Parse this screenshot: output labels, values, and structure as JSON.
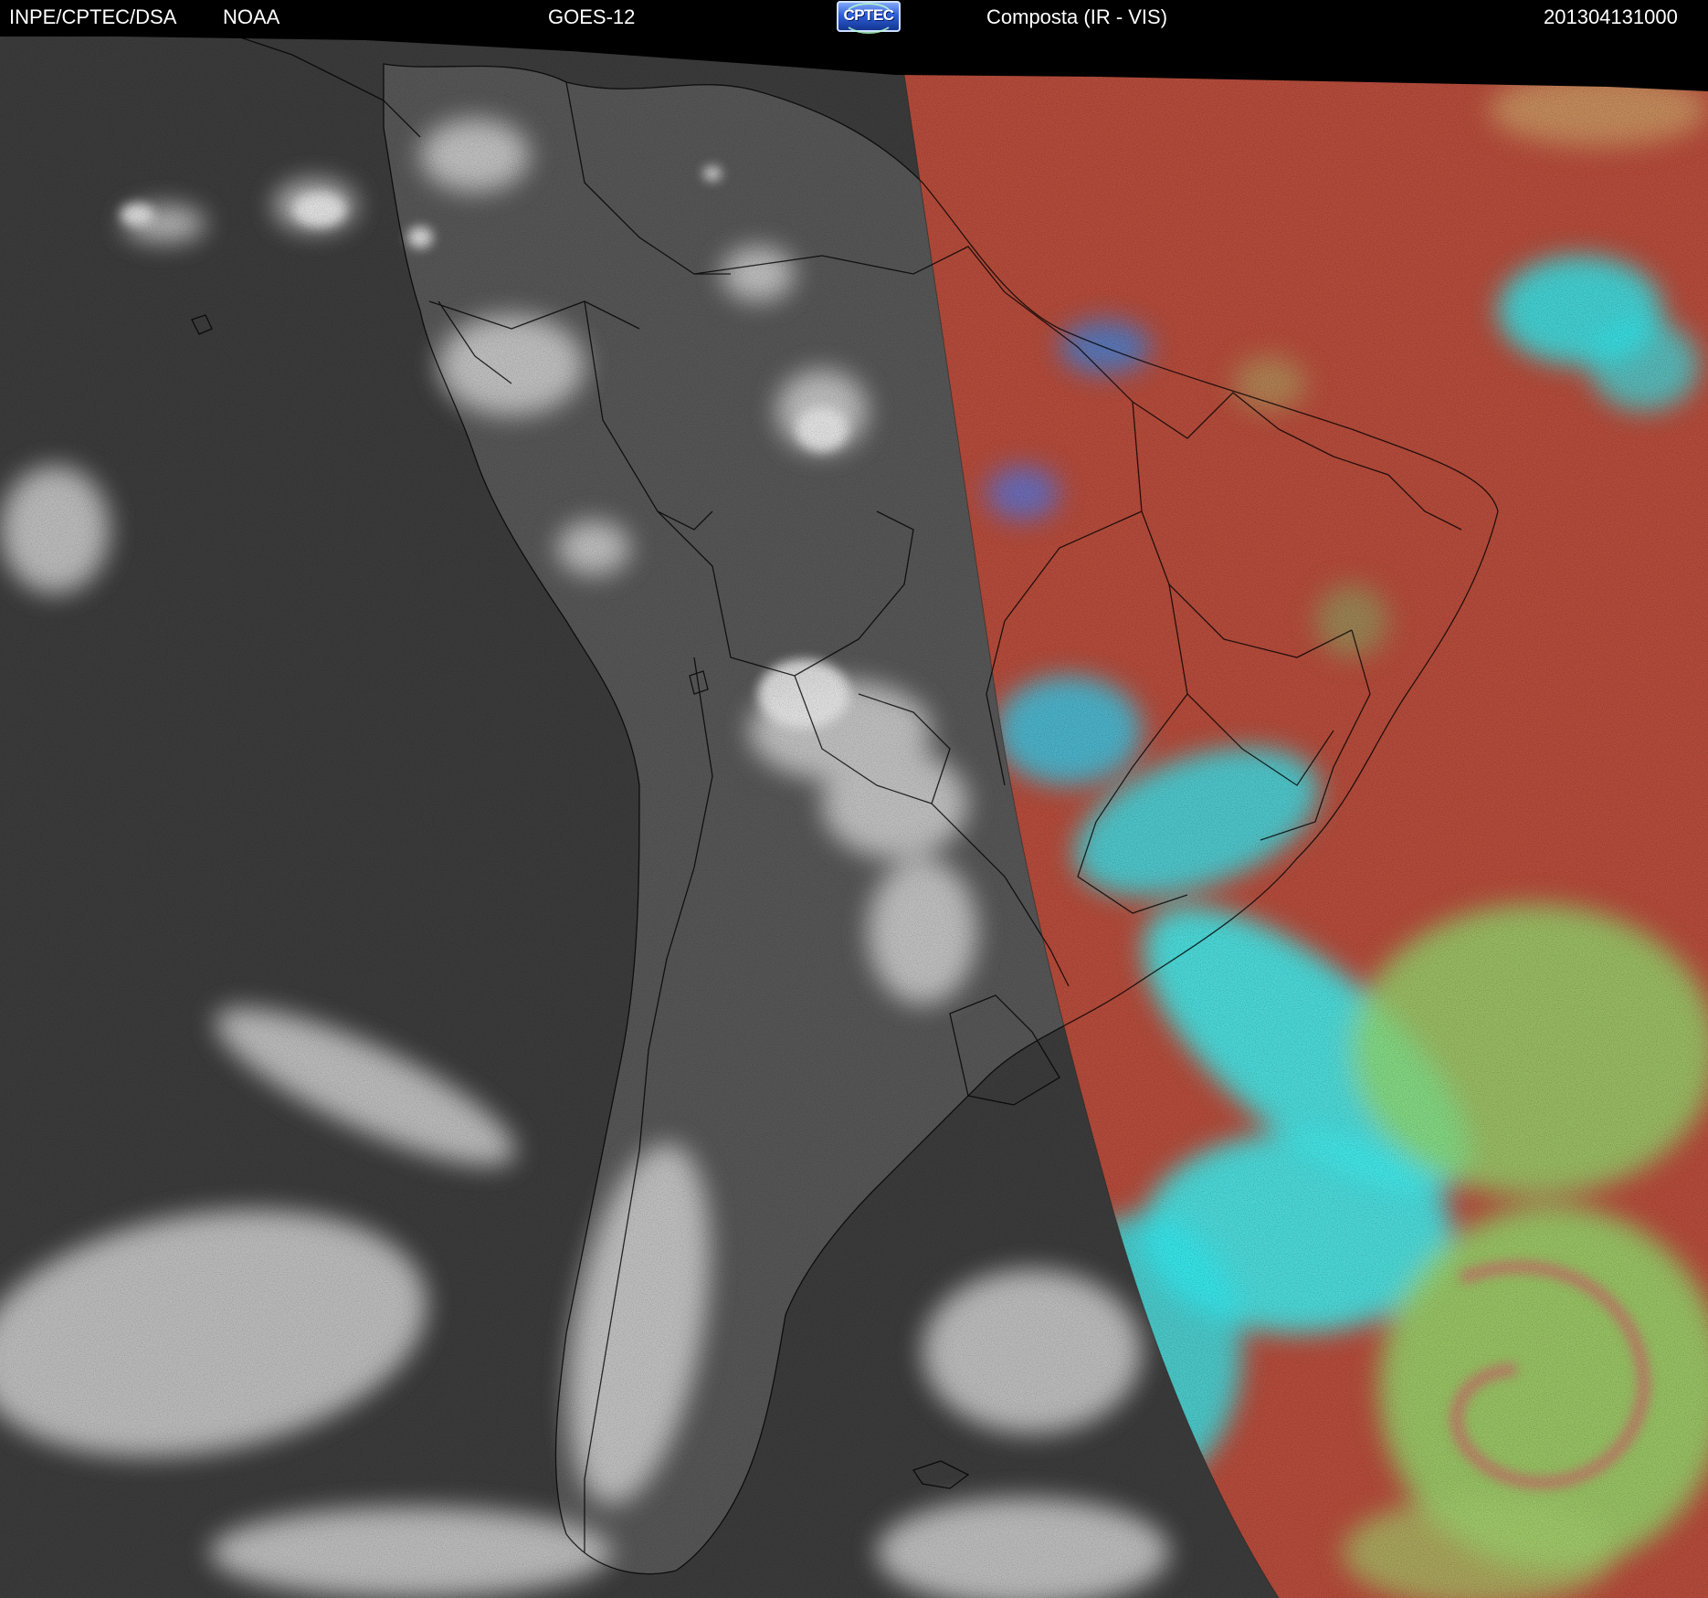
{
  "header": {
    "agency": "INPE/CPTEC/DSA",
    "source": "NOAA",
    "satellite": "GOES-12",
    "logo_text": "CPTEC",
    "product": "Composta (IR - VIS)",
    "timestamp": "201304131000"
  },
  "imagery": {
    "night_side": "infrared-grayscale",
    "day_side": "ir-vis-color-composite",
    "colors": {
      "background": "#000000",
      "ocean_ir": "#3a3a3a",
      "land_ir": "#565656",
      "cloud_ir": "#d8d8d8",
      "composite_warm": "#b24a3a",
      "composite_low_cloud": "#8fd36a",
      "composite_high_cloud": "#2ee3e8",
      "border_line": "#000000"
    }
  }
}
